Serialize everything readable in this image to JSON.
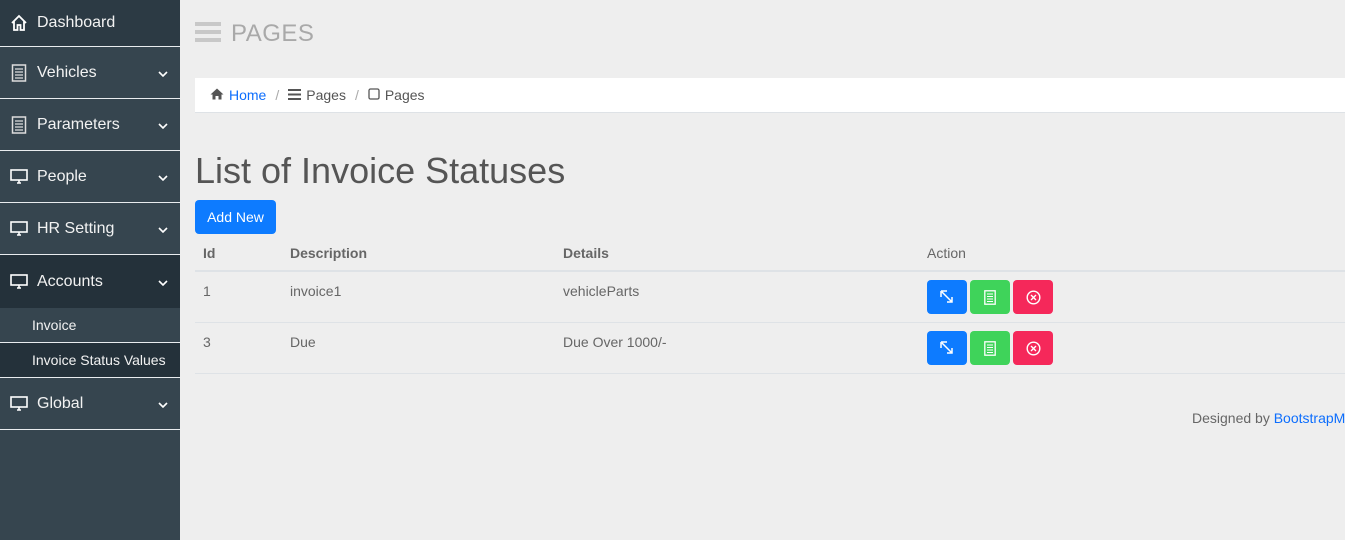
{
  "sidebar": {
    "items": [
      {
        "label": "Dashboard",
        "icon": "home-icon"
      },
      {
        "label": "Vehicles",
        "icon": "document-icon"
      },
      {
        "label": "Parameters",
        "icon": "document-icon"
      },
      {
        "label": "People",
        "icon": "monitor-icon"
      },
      {
        "label": "HR Setting",
        "icon": "monitor-icon"
      },
      {
        "label": "Accounts",
        "icon": "monitor-icon"
      },
      {
        "label": "Global",
        "icon": "monitor-icon"
      }
    ],
    "accounts_sub": [
      {
        "label": "Invoice"
      },
      {
        "label": "Invoice Status Values"
      }
    ]
  },
  "header": {
    "title": "PAGES"
  },
  "breadcrumb": [
    {
      "label": "Home"
    },
    {
      "label": "Pages"
    },
    {
      "label": "Pages"
    }
  ],
  "main": {
    "heading": "List of Invoice Statuses",
    "add_label": "Add New",
    "columns": [
      "Id",
      "Description",
      "Details",
      "Action"
    ],
    "rows": [
      {
        "id": "1",
        "description": "invoice1",
        "details": "vehicleParts"
      },
      {
        "id": "3",
        "description": "Due",
        "details": "Due Over 1000/-"
      }
    ]
  },
  "footer": {
    "text": "Designed by",
    "link": "BootstrapMade"
  },
  "colors": {
    "sidebar": "#36454f",
    "primary": "#0d7bff",
    "success": "#3fd35a",
    "danger": "#f5285a"
  }
}
